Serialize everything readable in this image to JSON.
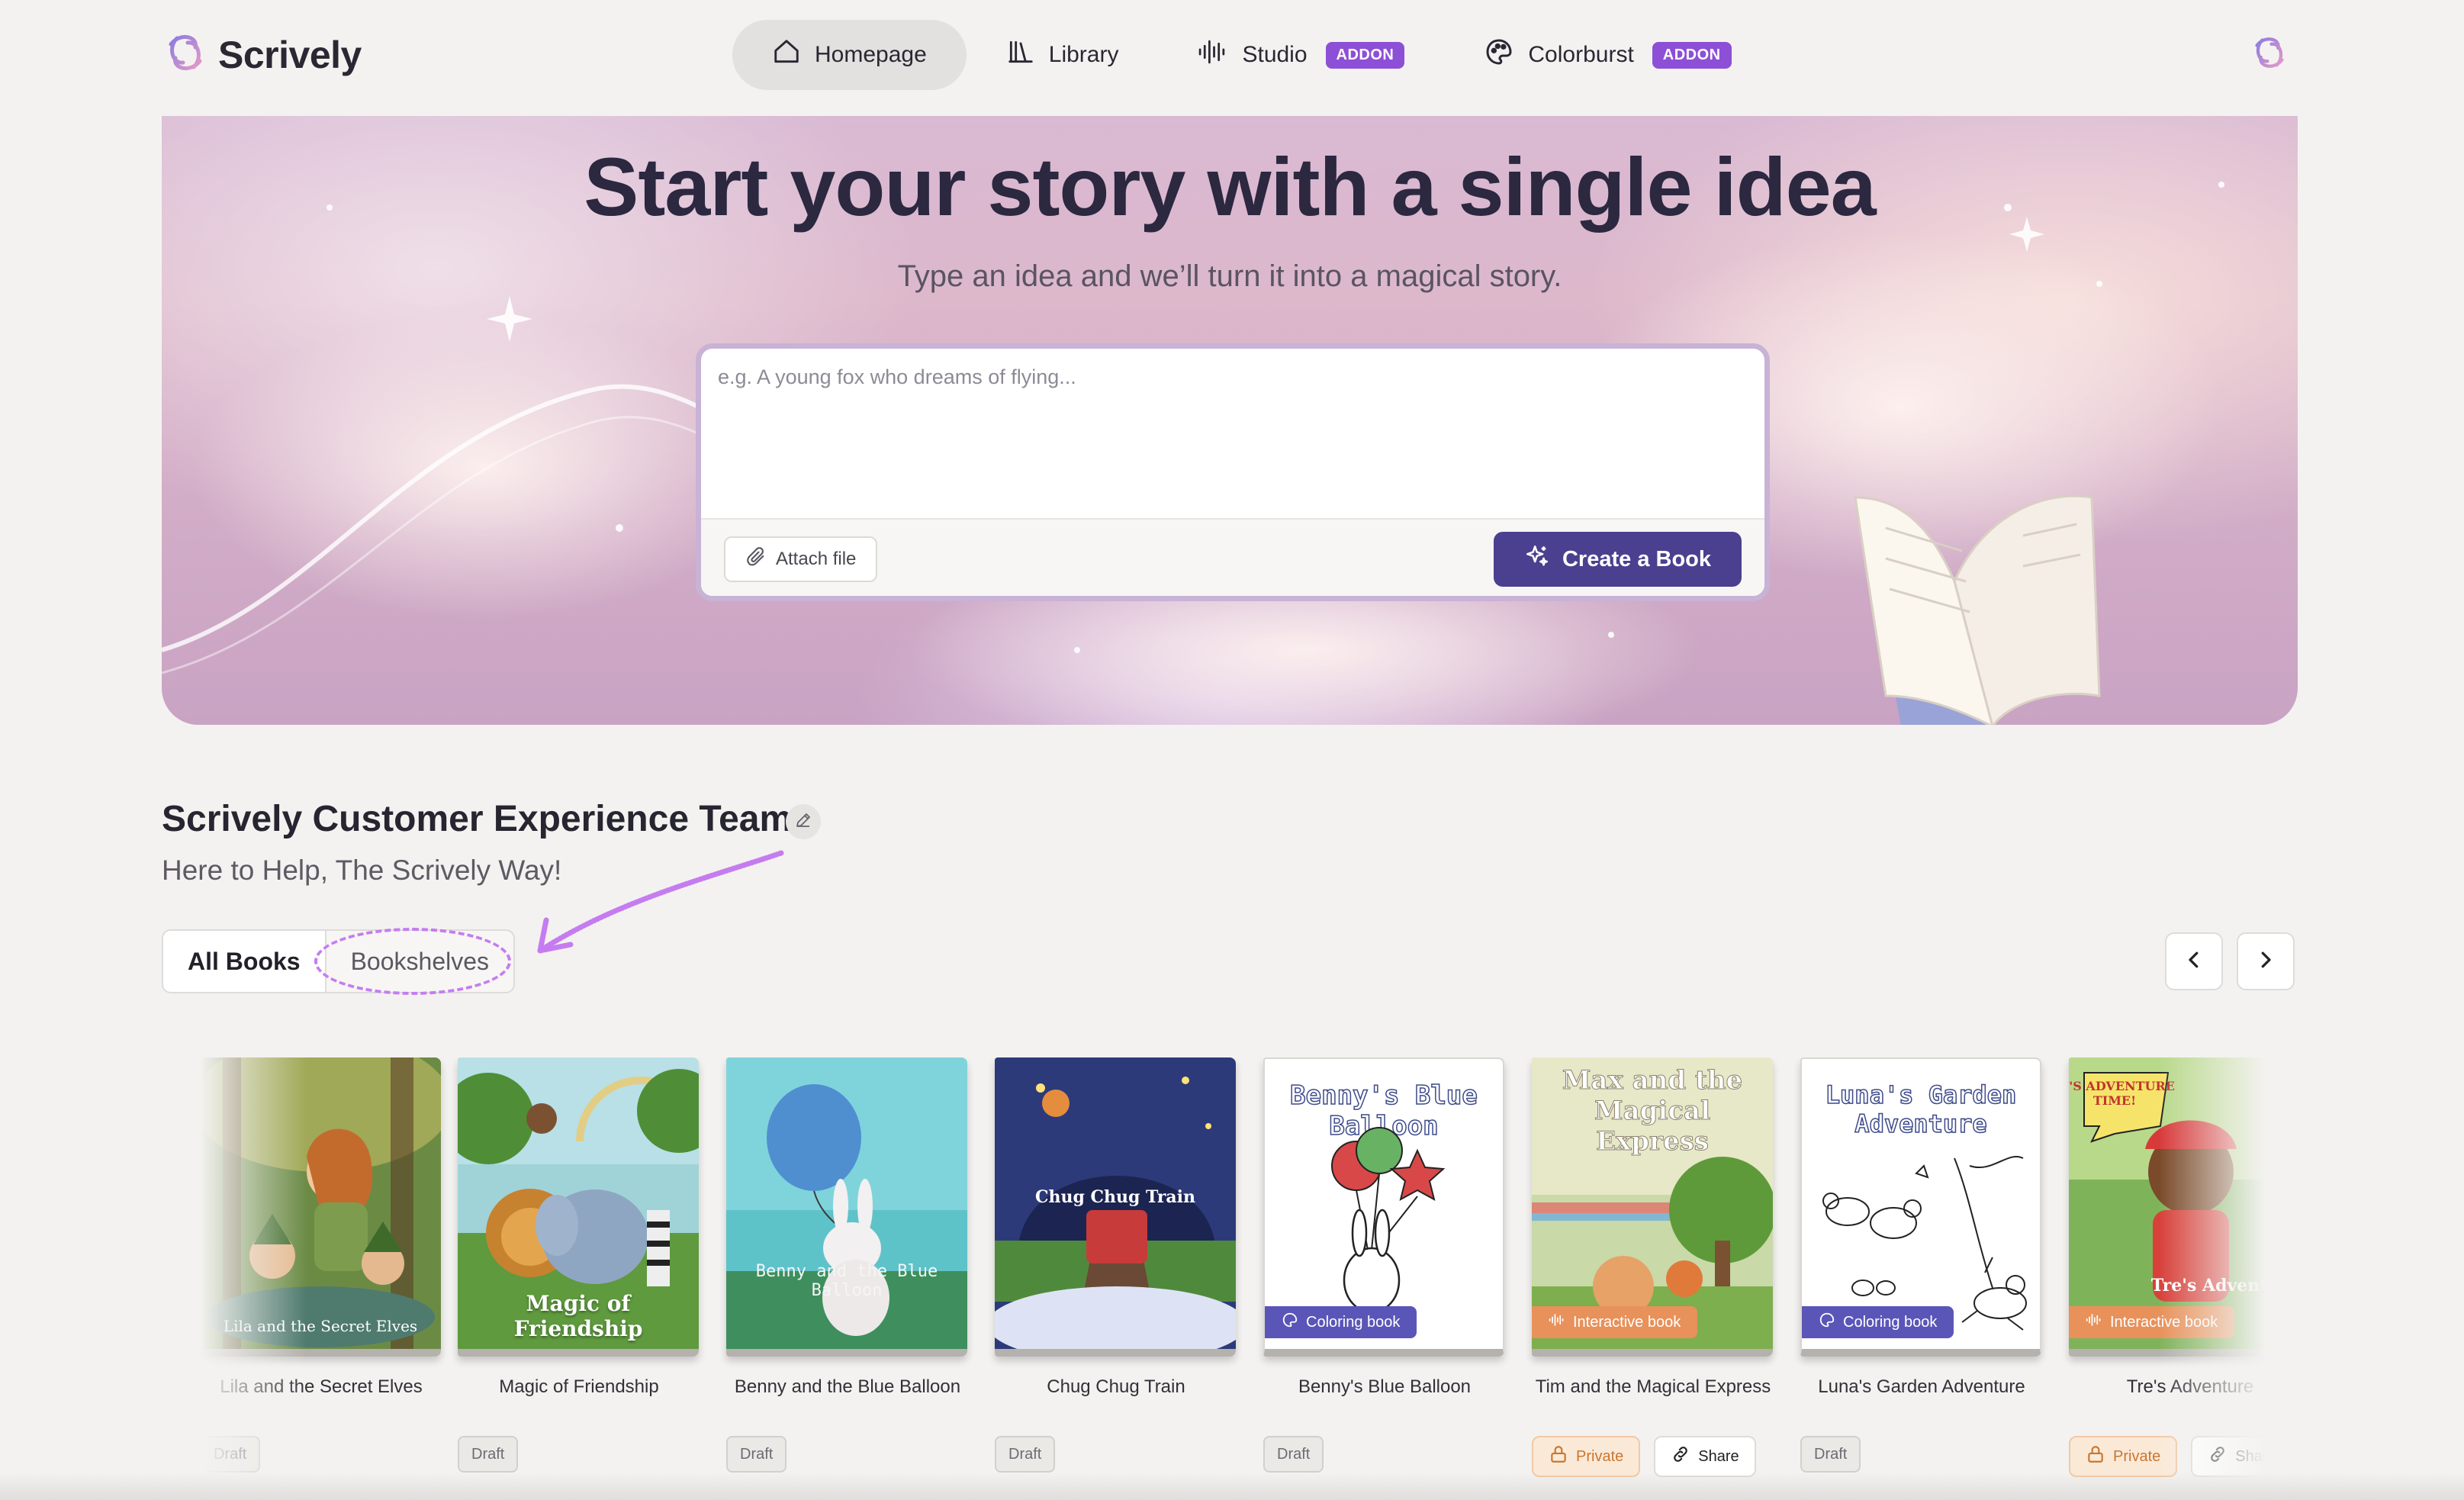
{
  "app": {
    "name": "Scrively"
  },
  "nav": {
    "items": [
      {
        "label": "Homepage",
        "icon": "home-icon",
        "active": true,
        "badge": ""
      },
      {
        "label": "Library",
        "icon": "library-icon",
        "active": false,
        "badge": ""
      },
      {
        "label": "Studio",
        "icon": "audio-wave-icon",
        "active": false,
        "badge": "ADDON"
      },
      {
        "label": "Colorburst",
        "icon": "palette-icon",
        "active": false,
        "badge": "ADDON"
      }
    ]
  },
  "hero": {
    "title": "Start your story with a single idea",
    "subtitle": "Type an idea and we’ll turn it into a magical story.",
    "input_placeholder": "e.g. A young fox who dreams of flying...",
    "attach_label": "Attach file",
    "create_label": "Create a Book"
  },
  "profile": {
    "name": "Scrively Customer Experience Team",
    "tagline": "Here to Help, The Scrively Way!"
  },
  "tabs": {
    "all_books": "All Books",
    "bookshelves": "Bookshelves"
  },
  "books": [
    {
      "title": "Lila and the Secret Elves",
      "cover_text": "Lila and the Secret Elves",
      "status": "Draft",
      "ribbon": ""
    },
    {
      "title": "Magic of Friendship",
      "cover_text": "Magic of Friendship",
      "status": "Draft",
      "ribbon": ""
    },
    {
      "title": "Benny and the Blue Balloon",
      "cover_text": "Benny and the Blue Balloon",
      "status": "Draft",
      "ribbon": ""
    },
    {
      "title": "Chug Chug Train",
      "cover_text": "Chug Chug Train",
      "status": "Draft",
      "ribbon": ""
    },
    {
      "title": "Benny's Blue Balloon",
      "cover_text": "Benny's Blue Balloon",
      "status": "Draft",
      "ribbon": "Coloring book"
    },
    {
      "title": "Tim and the Magical Express",
      "cover_text": "Max and the Magical Express",
      "status": "Private",
      "share": "Share",
      "ribbon": "Interactive book"
    },
    {
      "title": "Luna's Garden Adventure",
      "cover_text": "Luna's Garden Adventure",
      "status": "Draft",
      "ribbon": "Coloring book"
    },
    {
      "title": "Tre's Adventure",
      "cover_text": "Tre's Adventure",
      "bubble_text": "IT'S ADVENTURE TIME!",
      "status": "Private",
      "share": "Share",
      "ribbon": "Interactive book"
    }
  ],
  "colors": {
    "accent": "#8d4fd6",
    "primary_button": "#4b3f8f",
    "coloring_ribbon": "#5a56b8",
    "interactive_ribbon": "#e8915a",
    "annotation": "#c57cf0"
  }
}
